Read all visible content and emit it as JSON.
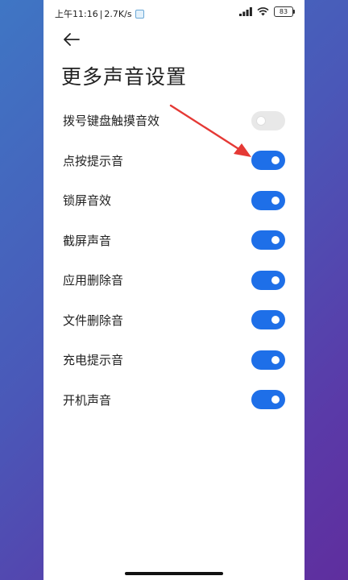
{
  "statusbar": {
    "time": "上午11:16",
    "separator": "|",
    "speed": "2.7K/s",
    "battery": "83"
  },
  "header": {
    "back_icon": "back-arrow-icon",
    "title": "更多声音设置"
  },
  "settings": [
    {
      "label": "拨号键盘触摸音效",
      "enabled": false
    },
    {
      "label": "点按提示音",
      "enabled": true
    },
    {
      "label": "锁屏音效",
      "enabled": true
    },
    {
      "label": "截屏声音",
      "enabled": true
    },
    {
      "label": "应用删除音",
      "enabled": true
    },
    {
      "label": "文件删除音",
      "enabled": true
    },
    {
      "label": "充电提示音",
      "enabled": true
    },
    {
      "label": "开机声音",
      "enabled": true
    }
  ],
  "colors": {
    "accent": "#1e6fe8",
    "toggle_off": "#e8e8e8",
    "annotation_arrow": "#e53935"
  }
}
